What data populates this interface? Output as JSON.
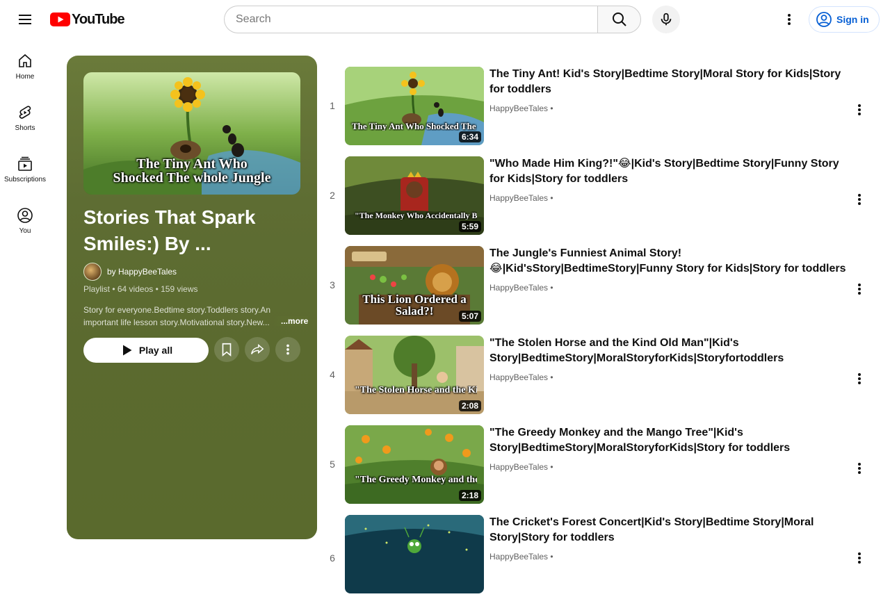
{
  "header": {
    "logo_text": "YouTube",
    "search_placeholder": "Search",
    "signin_label": "Sign in"
  },
  "guide": {
    "items": [
      {
        "label": "Home",
        "icon": "home-icon"
      },
      {
        "label": "Shorts",
        "icon": "shorts-icon"
      },
      {
        "label": "Subscriptions",
        "icon": "subscriptions-icon"
      },
      {
        "label": "You",
        "icon": "you-icon"
      }
    ]
  },
  "playlist": {
    "thumb_caption_line1": "The Tiny Ant Who",
    "thumb_caption_line2": "Shocked The whole Jungle",
    "title": "Stories That Spark Smiles:) By ...",
    "owner": "by HappyBeeTales",
    "meta": "Playlist • 64 videos • 159 views",
    "description": "Story for everyone.Bedtime story.Toddlers story.An important life lesson story.Motivational story.New...",
    "more_label": "...more",
    "play_all_label": "Play all",
    "card_color": "#5b6a2f"
  },
  "videos": [
    {
      "index": "1",
      "title": "The Tiny Ant! Kid's Story|Bedtime Story|Moral Story for Kids|Story for toddlers",
      "channel": "HappyBeeTales •",
      "duration": "6:34",
      "thumb_caption": "The Tiny Ant Who Shocked The whole Jun"
    },
    {
      "index": "2",
      "title": "\"Who Made Him King?!\"😂|Kid's Story|Bedtime Story|Funny Story for Kids|Story for toddlers",
      "channel": "HappyBeeTales •",
      "duration": "5:59",
      "thumb_caption": "\"The Monkey Who Accidentally Became Kir"
    },
    {
      "index": "3",
      "title": "The Jungle's Funniest Animal Story!😂|Kid'sStory|BedtimeStory|Funny Story for Kids|Story for toddlers",
      "channel": "HappyBeeTales •",
      "duration": "5:07",
      "thumb_caption": "This Lion Ordered a Salad?!"
    },
    {
      "index": "4",
      "title": "\"The Stolen Horse and the Kind Old Man\"|Kid's Story|BedtimeStory|MoralStoryforKids|Storyfortoddlers",
      "channel": "HappyBeeTales •",
      "duration": "2:08",
      "thumb_caption": "\"The Stolen Horse and the Kind Old Man"
    },
    {
      "index": "5",
      "title": "\"The Greedy Monkey and the Mango Tree\"|Kid's Story|BedtimeStory|MoralStoryforKids|Story for toddlers",
      "channel": "HappyBeeTales •",
      "duration": "2:18",
      "thumb_caption": "\"The Greedy Monkey and the Mango Tre"
    },
    {
      "index": "6",
      "title": "The Cricket's Forest Concert|Kid's Story|Bedtime Story|Moral Story|Story for toddlers",
      "channel": "HappyBeeTales •",
      "duration": "",
      "thumb_caption": ""
    }
  ],
  "colors": {
    "brand_red": "#ff0000",
    "link_blue": "#065fd4"
  }
}
